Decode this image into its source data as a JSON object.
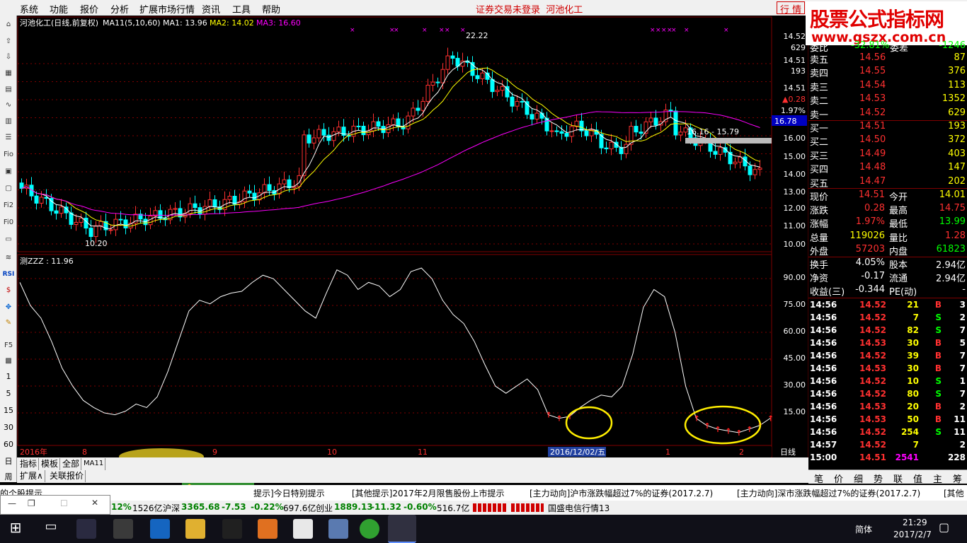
{
  "menu": {
    "items": [
      "系统",
      "功能",
      "报价",
      "分析",
      "扩展市场行情",
      "资讯",
      "工具",
      "帮助"
    ],
    "status_title": "证券交易未登录",
    "stock_name": "河池化工",
    "right_tabs": "行 情"
  },
  "watermark": {
    "title": "股票公式指标网",
    "url": "www.gszx.com.cn"
  },
  "toolbar": {
    "numbers": [
      "1",
      "5",
      "15",
      "30",
      "60"
    ],
    "labels": [
      "F5",
      "RSI",
      "Fio",
      "Fi2",
      "Fi0"
    ],
    "bottom_labels": [
      "日",
      "周"
    ]
  },
  "kline": {
    "header": "河池化工(日线,前复权)",
    "ma_label": "MA11(5,10,60)",
    "ma1": "MA1: 13.96",
    "ma2": "MA2: 14.02",
    "ma3": "MA3: 16.60",
    "high_label": "22.22",
    "low_label": "10.20",
    "range_label": "16.16 - 15.79",
    "axis_right": [
      "14.52",
      "629",
      "14.51",
      "193",
      "14.51",
      "▲0.28",
      "1.97%",
      "16.00",
      "15.00",
      "14.00",
      "13.00",
      "12.00",
      "11.00",
      "10.00"
    ],
    "price_tag": "16.78",
    "colors": {
      "up": "#ff3030",
      "down": "#00ffff",
      "ma1": "#ffffff",
      "ma2": "#ffff00",
      "ma3": "#ff00ff",
      "grid": "#800000"
    }
  },
  "chart_data": {
    "type": "line",
    "title": "测ZZZ : 11.96",
    "y_ticks": [
      "90.00",
      "75.00",
      "60.00",
      "45.00",
      "30.00",
      "15.00"
    ],
    "ylim": [
      0,
      100
    ],
    "x": [
      "2016年",
      "8",
      "9",
      "10",
      "11",
      "12",
      "1",
      "2"
    ],
    "values": [
      88,
      75,
      68,
      55,
      40,
      30,
      22,
      18,
      15,
      14,
      16,
      20,
      18,
      24,
      38,
      55,
      72,
      78,
      76,
      80,
      82,
      83,
      88,
      92,
      90,
      84,
      78,
      72,
      68,
      82,
      95,
      92,
      84,
      88,
      86,
      80,
      84,
      94,
      96,
      90,
      78,
      70,
      65,
      55,
      42,
      30,
      26,
      30,
      34,
      28,
      14,
      12,
      13,
      18,
      22,
      25,
      24,
      30,
      48,
      74,
      84,
      80,
      60,
      30,
      12,
      8,
      6,
      5,
      4,
      6,
      8,
      12
    ]
  },
  "timeline": {
    "date_badge": "2016/12/02/五",
    "year": "2016年",
    "months": [
      "8",
      "9",
      "10",
      "11",
      "1",
      "2"
    ],
    "right_label": "日线"
  },
  "quote": {
    "header": {
      "l1": "委比",
      "v1": "-32.81%",
      "l2": "委差",
      "v2": "-1246"
    },
    "sell": [
      {
        "label": "卖五",
        "price": "14.56",
        "vol": "87"
      },
      {
        "label": "卖四",
        "price": "14.55",
        "vol": "376"
      },
      {
        "label": "卖三",
        "price": "14.54",
        "vol": "113"
      },
      {
        "label": "卖二",
        "price": "14.53",
        "vol": "1352"
      },
      {
        "label": "卖一",
        "price": "14.52",
        "vol": "629"
      }
    ],
    "buy": [
      {
        "label": "买一",
        "price": "14.51",
        "vol": "193"
      },
      {
        "label": "买二",
        "price": "14.50",
        "vol": "372"
      },
      {
        "label": "买三",
        "price": "14.49",
        "vol": "403"
      },
      {
        "label": "买四",
        "price": "14.48",
        "vol": "147"
      },
      {
        "label": "买五",
        "price": "14.47",
        "vol": "202"
      }
    ],
    "stats": [
      {
        "l1": "现价",
        "v1": "14.51",
        "l2": "今开",
        "v2": "14.01"
      },
      {
        "l1": "涨跌",
        "v1": "0.28",
        "l2": "最高",
        "v2": "14.75"
      },
      {
        "l1": "涨幅",
        "v1": "1.97%",
        "l2": "最低",
        "v2": "13.99"
      },
      {
        "l1": "总量",
        "v1": "119026",
        "l2": "量比",
        "v2": "1.28"
      },
      {
        "l1": "外盘",
        "v1": "57203",
        "l2": "内盘",
        "v2": "61823"
      }
    ],
    "fund": [
      {
        "l1": "换手",
        "v1": "4.05%",
        "l2": "股本",
        "v2": "2.94亿"
      },
      {
        "l1": "净资",
        "v1": "-0.17",
        "l2": "流通",
        "v2": "2.94亿"
      },
      {
        "l1": "收益(三)",
        "v1": "-0.344",
        "l2": "PE(动)",
        "v2": "-"
      }
    ],
    "ticks": [
      {
        "time": "14:56",
        "price": "14.52",
        "vol": "21",
        "side": "B",
        "n": "3"
      },
      {
        "time": "14:56",
        "price": "14.52",
        "vol": "7",
        "side": "S",
        "n": "2"
      },
      {
        "time": "14:56",
        "price": "14.52",
        "vol": "82",
        "side": "S",
        "n": "7"
      },
      {
        "time": "14:56",
        "price": "14.53",
        "vol": "30",
        "side": "B",
        "n": "5"
      },
      {
        "time": "14:56",
        "price": "14.52",
        "vol": "39",
        "side": "B",
        "n": "7"
      },
      {
        "time": "14:56",
        "price": "14.53",
        "vol": "30",
        "side": "B",
        "n": "7"
      },
      {
        "time": "14:56",
        "price": "14.52",
        "vol": "10",
        "side": "S",
        "n": "1"
      },
      {
        "time": "14:56",
        "price": "14.52",
        "vol": "80",
        "side": "S",
        "n": "7"
      },
      {
        "time": "14:56",
        "price": "14.53",
        "vol": "20",
        "side": "B",
        "n": "2"
      },
      {
        "time": "14:56",
        "price": "14.53",
        "vol": "50",
        "side": "B",
        "n": "11"
      },
      {
        "time": "14:56",
        "price": "14.52",
        "vol": "254",
        "side": "S",
        "n": "11"
      },
      {
        "time": "14:57",
        "price": "14.52",
        "vol": "7",
        "side": "",
        "n": "2"
      },
      {
        "time": "15:00",
        "price": "14.51",
        "vol": "2541",
        "side": "",
        "n": "228"
      }
    ],
    "tabs": [
      "笔",
      "价",
      "细",
      "势",
      "联",
      "值",
      "主",
      "筹"
    ]
  },
  "bottom_tabs": [
    "指标",
    "模板",
    "全部",
    "MA11",
    "扩展∧",
    "关联报价"
  ],
  "minitool": "简 田",
  "ticker": [
    "的个股提示",
    "提示]今日特别提示",
    "[其他提示]2017年2月限售股份上市提示",
    "[主力动向]沪市涨跌幅超过7%的证券(2017.2.7)",
    "[主力动向]深市涨跌幅超过7%的证券(2017.2.7)",
    "[其他"
  ],
  "statusbar": {
    "a": "12%",
    "b": "1526亿",
    "sh_label": "沪深",
    "sh_val": "3365.68",
    "sh_chg": "-7.53",
    "sh_pct": "-0.22%",
    "sh_amt": "697.6亿",
    "cy_label": "创业",
    "cy_val": "1889.13",
    "cy_chg": "-11.32",
    "cy_pct": "-0.60%",
    "cy_amt": "516.7亿",
    "broker": "国盛电信行情13"
  },
  "taskbar": {
    "lang": "简体",
    "time": "21:29",
    "date": "2017/2/7"
  }
}
